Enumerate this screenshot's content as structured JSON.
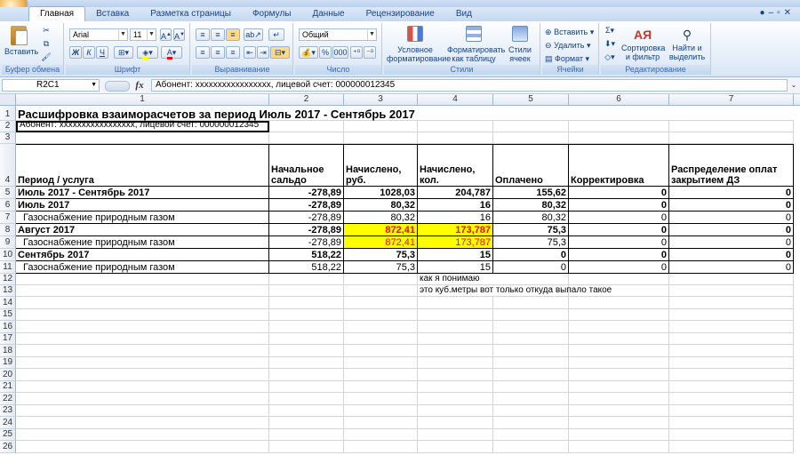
{
  "ribbon_tabs": [
    "Главная",
    "Вставка",
    "Разметка страницы",
    "Формулы",
    "Данные",
    "Рецензирование",
    "Вид"
  ],
  "groups": {
    "clipboard": {
      "label": "Буфер обмена",
      "paste": "Вставить"
    },
    "font": {
      "label": "Шрифт",
      "font_name": "Arial",
      "font_size": "11",
      "bold": "Ж",
      "italic": "К",
      "underline": "Ч"
    },
    "alignment": {
      "label": "Выравнивание"
    },
    "number": {
      "label": "Число",
      "format": "Общий",
      "percent": "%",
      "thousands": "000"
    },
    "styles": {
      "label": "Стили",
      "conditional": "Условное форматирование",
      "format_table": "Форматировать как таблицу",
      "cell_styles": "Стили ячеек"
    },
    "cells": {
      "label": "Ячейки",
      "insert": "Вставить",
      "delete": "Удалить",
      "format": "Формат"
    },
    "editing": {
      "label": "Редактирование",
      "sort": "Сортировка и фильтр",
      "find": "Найти и выделить"
    }
  },
  "formula_bar": {
    "name_box": "R2C1",
    "fx": "fx",
    "formula": "Абонент: xxxxxxxxxxxxxxxxx, лицевой счет: 000000012345"
  },
  "columns": [
    "1",
    "2",
    "3",
    "4",
    "5",
    "6",
    "7"
  ],
  "rows": {
    "r1": {
      "num": "1",
      "a": "Расшифровка взаиморасчетов за период Июль 2017 - Сентябрь 2017"
    },
    "r2": {
      "num": "2",
      "a": "Абонент: xxxxxxxxxxxxxxxxx, лицевой счет: 000000012345"
    },
    "r3": {
      "num": "3"
    },
    "r4": {
      "num": "4",
      "c1": "Период / услуга",
      "c2": "Начальное сальдо",
      "c3": "Начислено, руб.",
      "c4": "Начислено, кол.",
      "c5": "Оплачено",
      "c6": "Корректировка",
      "c7": "Распределение оплат закрытием ДЗ"
    },
    "r5": {
      "num": "5",
      "c1": "Июль 2017 - Сентябрь 2017",
      "c2": "-278,89",
      "c3": "1028,03",
      "c4": "204,787",
      "c5": "155,62",
      "c6": "0",
      "c7": "0"
    },
    "r6": {
      "num": "6",
      "c1": "Июль 2017",
      "c2": "-278,89",
      "c3": "80,32",
      "c4": "16",
      "c5": "80,32",
      "c6": "0",
      "c7": "0"
    },
    "r7": {
      "num": "7",
      "c1": "Газоснабжение природным газом",
      "c2": "-278,89",
      "c3": "80,32",
      "c4": "16",
      "c5": "80,32",
      "c6": "0",
      "c7": "0"
    },
    "r8": {
      "num": "8",
      "c1": "Август 2017",
      "c2": "-278,89",
      "c3": "872,41",
      "c4": "173,787",
      "c5": "75,3",
      "c6": "0",
      "c7": "0"
    },
    "r9": {
      "num": "9",
      "c1": "Газоснабжение природным газом",
      "c2": "-278,89",
      "c3": "872,41",
      "c4": "173,787",
      "c5": "75,3",
      "c6": "0",
      "c7": "0"
    },
    "r10": {
      "num": "10",
      "c1": "Сентябрь 2017",
      "c2": "518,22",
      "c3": "75,3",
      "c4": "15",
      "c5": "0",
      "c6": "0",
      "c7": "0"
    },
    "r11": {
      "num": "11",
      "c1": "Газоснабжение природным газом",
      "c2": "518,22",
      "c3": "75,3",
      "c4": "15",
      "c5": "0",
      "c6": "0",
      "c7": "0"
    },
    "r12": {
      "num": "12",
      "note": "как я понимаю"
    },
    "r13": {
      "num": "13",
      "note": "это куб.метры вот только откуда выпало такое"
    }
  },
  "empty_rows": [
    "14",
    "15",
    "16",
    "17",
    "18",
    "19",
    "20",
    "21",
    "22",
    "23",
    "24",
    "25",
    "26"
  ]
}
